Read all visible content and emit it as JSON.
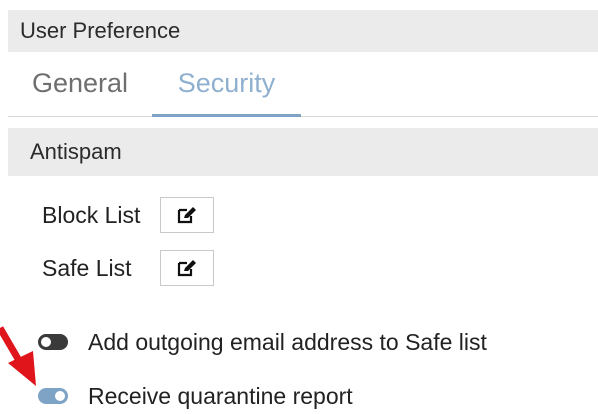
{
  "header": {
    "title": "User Preference"
  },
  "tabs": [
    {
      "label": "General",
      "active": false
    },
    {
      "label": "Security",
      "active": true
    }
  ],
  "antispam": {
    "section_title": "Antispam",
    "lists": [
      {
        "label": "Block List",
        "icon": "edit-icon"
      },
      {
        "label": "Safe List",
        "icon": "edit-icon"
      }
    ],
    "toggles": [
      {
        "label": "Add outgoing email address to Safe list",
        "enabled": false
      },
      {
        "label": "Receive quarantine report",
        "enabled": true
      }
    ]
  },
  "colors": {
    "accent": "#7fa3c5",
    "tab_active_text": "#8fb0cf",
    "section_background": "#ebebeb",
    "toggle_off": "#3a3a3a",
    "annotation_arrow": "#e0141b"
  }
}
